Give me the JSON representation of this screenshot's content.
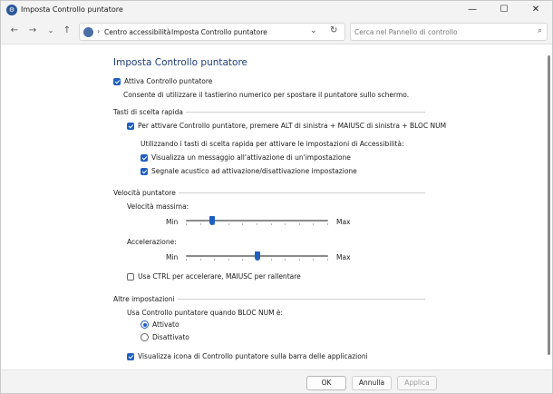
{
  "window": {
    "title": "Imposta Controllo puntatore",
    "minimize_glyph": "—",
    "maximize_glyph": "☐",
    "close_glyph": "✕"
  },
  "navigation": {
    "back_icon": "arrow-left-icon",
    "forward_icon": "arrow-right-icon",
    "history_icon": "chevron-down-icon",
    "up_icon": "arrow-up-icon",
    "breadcrumb": [
      "Centro accessibilità",
      "Imposta Controllo puntatore"
    ],
    "search_placeholder": "Cerca nel Pannello di controllo"
  },
  "page": {
    "heading": "Imposta Controllo puntatore",
    "enable": {
      "label": "Attiva Controllo puntatore",
      "checked": true
    },
    "enable_desc": "Consente di utilizzare il tastierino numerico per spostare il puntatore sullo schermo.",
    "shortcuts": {
      "group_label": "Tasti di scelta rapida",
      "alt_shortcut": {
        "label": "Per attivare Controllo puntatore, premere ALT di sinistra + MAIUSC di sinistra + BLOC NUM",
        "checked": true
      },
      "intro": "Utilizzando i tasti di scelta rapida per attivare le impostazioni di Accessibilità:",
      "show_message": {
        "label": "Visualizza un messaggio all'attivazione di un'impostazione",
        "checked": true
      },
      "beep": {
        "label": "Segnale acustico ad attivazione/disattivazione impostazione",
        "checked": true
      }
    },
    "speed": {
      "group_label": "Velocità puntatore",
      "top_speed_label": "Velocità massima:",
      "top_speed_value": 0.17,
      "acceleration_label": "Accelerazione:",
      "acceleration_value": 0.5,
      "min_label": "Min",
      "max_label": "Max",
      "ctrl_shift": {
        "label": "Usa CTRL per accelerare, MAIUSC per rallentare",
        "checked": false
      }
    },
    "other": {
      "group_label": "Altre impostazioni",
      "numlock_label": "Usa Controllo puntatore quando BLOC NUM è:",
      "on_option": {
        "label": "Attivato",
        "selected": true
      },
      "off_option": {
        "label": "Disattivato",
        "selected": false
      },
      "taskbar_icon": {
        "label": "Visualizza icona di Controllo puntatore sulla barra delle applicazioni",
        "checked": true
      }
    }
  },
  "footer": {
    "ok_label": "OK",
    "cancel_label": "Annulla",
    "apply_label": "Applica"
  },
  "colors": {
    "accent": "#1f5fc0",
    "heading": "#1e3c78"
  }
}
